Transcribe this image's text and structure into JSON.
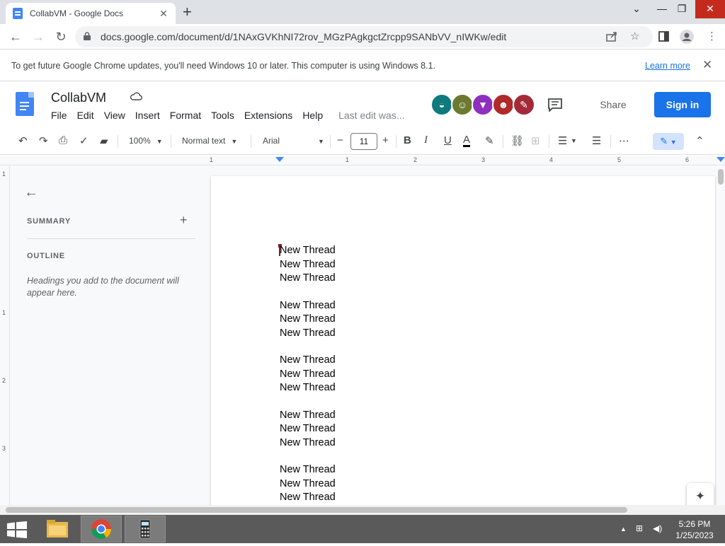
{
  "browser": {
    "tab_title": "CollabVM - Google Docs",
    "tab_close": "✕",
    "new_tab": "+",
    "url": "docs.google.com/document/d/1NAxGVKhNI72rov_MGzPAgkgctZrcpp9SANbVV_nIWKw/edit",
    "window": {
      "minimize": "⌄",
      "maximize": "—",
      "restore": "❐",
      "close": "✕"
    },
    "nav": {
      "back": "←",
      "forward": "→",
      "reload": "↻"
    }
  },
  "infobar": {
    "message": "To get future Google Chrome updates, you'll need Windows 10 or later. This computer is using Windows 8.1.",
    "link": "Learn more",
    "close": "✕"
  },
  "docs": {
    "title": "CollabVM",
    "menu": [
      "File",
      "Edit",
      "View",
      "Insert",
      "Format",
      "Tools",
      "Extensions",
      "Help"
    ],
    "last_edit": "Last edit was...",
    "share": "Share",
    "sign_in": "Sign in",
    "avatar_colors": [
      "#0f7b7d",
      "#6b7a2f",
      "#8e2fbf",
      "#b02a2a",
      "#a42a3a"
    ],
    "accent": "#1a73e8"
  },
  "format_toolbar": {
    "zoom": "100%",
    "style": "Normal text",
    "font": "Arial",
    "font_size": "11",
    "minus": "−",
    "plus": "+",
    "bold": "B",
    "italic": "I",
    "underline": "U",
    "text_color": "A",
    "more": "⋯"
  },
  "ruler": {
    "numbers": [
      "1",
      "1",
      "2",
      "3",
      "4",
      "5",
      "6"
    ],
    "vertical_numbers": [
      "1",
      "1",
      "2",
      "3"
    ]
  },
  "outline": {
    "summary": "SUMMARY",
    "outline": "OUTLINE",
    "hint": "Headings you add to the document will appear here."
  },
  "document": {
    "lines": [
      "New Thread",
      "New Thread",
      "New Thread",
      "",
      "New Thread",
      "New Thread",
      "New Thread",
      "",
      "New Thread",
      "New Thread",
      "New Thread",
      "",
      "New Thread",
      "New Thread",
      "New Thread",
      "",
      "New Thread",
      "New Thread",
      "New Thread"
    ]
  },
  "taskbar": {
    "time": "5:26 PM",
    "date": "1/25/2023"
  }
}
